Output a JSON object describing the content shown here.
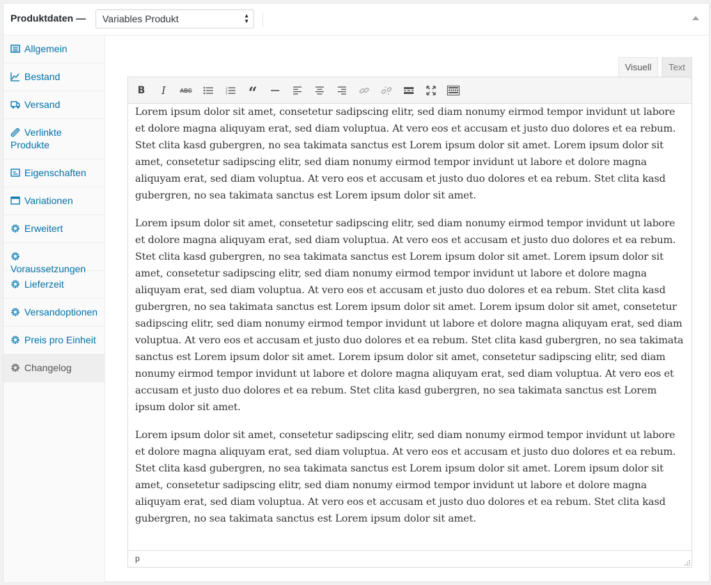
{
  "header": {
    "title": "Produktdaten —",
    "product_type": "Variables Produkt"
  },
  "sidebar": {
    "items": [
      {
        "label": "Allgemein",
        "icon": "general-icon"
      },
      {
        "label": "Bestand",
        "icon": "inventory-icon"
      },
      {
        "label": "Versand",
        "icon": "shipping-icon"
      },
      {
        "label": "Verlinkte Produkte",
        "icon": "linked-products-icon"
      },
      {
        "label": "Eigenschaften",
        "icon": "attributes-icon"
      },
      {
        "label": "Variationen",
        "icon": "variations-icon"
      },
      {
        "label": "Erweitert",
        "icon": "gear-icon"
      },
      {
        "label": "Voraussetzungen",
        "icon": "gear-icon"
      },
      {
        "label": "Lieferzeit",
        "icon": "gear-icon"
      },
      {
        "label": "Versandoptionen",
        "icon": "gear-icon"
      },
      {
        "label": "Preis pro Einheit",
        "icon": "gear-icon"
      },
      {
        "label": "Changelog",
        "icon": "gear-icon",
        "active": true
      }
    ]
  },
  "editor": {
    "tabs": {
      "visual": "Visuell",
      "text": "Text",
      "active": "Visuell"
    },
    "toolbar": [
      "bold",
      "italic",
      "strikethrough",
      "bullet-list",
      "numbered-list",
      "blockquote",
      "horizontal-line",
      "align-left",
      "align-center",
      "align-right",
      "insert-link",
      "remove-link",
      "read-more",
      "fullscreen",
      "toolbar-toggle"
    ],
    "paragraphs": [
      "Lorem ipsum dolor sit amet, consetetur sadipscing elitr, sed diam nonumy eirmod tempor invidunt ut labore et dolore magna aliquyam erat, sed diam voluptua. At vero eos et accusam et justo duo dolores et ea rebum. Stet clita kasd gubergren, no sea takimata sanctus est Lorem ipsum dolor sit amet. Lorem ipsum dolor sit amet, consetetur sadipscing elitr, sed diam nonumy eirmod tempor invidunt ut labore et dolore magna aliquyam erat, sed diam voluptua. At vero eos et accusam et justo duo dolores et ea rebum. Stet clita kasd gubergren, no sea takimata sanctus est Lorem ipsum dolor sit amet.",
      "Lorem ipsum dolor sit amet, consetetur sadipscing elitr, sed diam nonumy eirmod tempor invidunt ut labore et dolore magna aliquyam erat, sed diam voluptua. At vero eos et accusam et justo duo dolores et ea rebum. Stet clita kasd gubergren, no sea takimata sanctus est Lorem ipsum dolor sit amet. Lorem ipsum dolor sit amet, consetetur sadipscing elitr, sed diam nonumy eirmod tempor invidunt ut labore et dolore magna aliquyam erat, sed diam voluptua. At vero eos et accusam et justo duo dolores et ea rebum. Stet clita kasd gubergren, no sea takimata sanctus est Lorem ipsum dolor sit amet. Lorem ipsum dolor sit amet, consetetur sadipscing elitr, sed diam nonumy eirmod tempor invidunt ut labore et dolore magna aliquyam erat, sed diam voluptua. At vero eos et accusam et justo duo dolores et ea rebum. Stet clita kasd gubergren, no sea takimata sanctus est Lorem ipsum dolor sit amet. Lorem ipsum dolor sit amet, consetetur sadipscing elitr, sed diam nonumy eirmod tempor invidunt ut labore et dolore magna aliquyam erat, sed diam voluptua. At vero eos et accusam et justo duo dolores et ea rebum. Stet clita kasd gubergren, no sea takimata sanctus est Lorem ipsum dolor sit amet.",
      "Lorem ipsum dolor sit amet, consetetur sadipscing elitr, sed diam nonumy eirmod tempor invidunt ut labore et dolore magna aliquyam erat, sed diam voluptua. At vero eos et accusam et justo duo dolores et ea rebum. Stet clita kasd gubergren, no sea takimata sanctus est Lorem ipsum dolor sit amet. Lorem ipsum dolor sit amet, consetetur sadipscing elitr, sed diam nonumy eirmod tempor invidunt ut labore et dolore magna aliquyam erat, sed diam voluptua. At vero eos et accusam et justo duo dolores et ea rebum. Stet clita kasd gubergren, no sea takimata sanctus est Lorem ipsum dolor sit amet."
    ],
    "status_path": "p"
  },
  "colors": {
    "link": "#0073aa",
    "active_tab_text": "#555555",
    "sidebar_bg": "#fafafa",
    "toolbar_bg": "#f5f5f5"
  }
}
